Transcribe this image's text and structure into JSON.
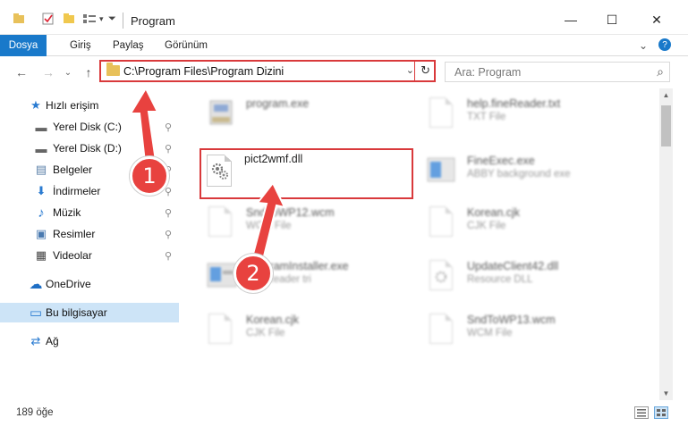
{
  "window": {
    "title": "Program",
    "minimize_glyph": "—",
    "maximize_glyph": "☐",
    "close_glyph": "✕"
  },
  "ribbon": {
    "file": "Dosya",
    "home": "Giriş",
    "share": "Paylaş",
    "view": "Görünüm",
    "expand_glyph": "⌄",
    "help_glyph": "?"
  },
  "nav": {
    "back_glyph": "←",
    "forward_glyph": "→",
    "recent_glyph": "⌄",
    "up_glyph": "↑",
    "address_path": "C:\\Program Files\\Program Dizini",
    "address_dropdown_glyph": "⌄",
    "refresh_glyph": "↻",
    "search_placeholder": "Ara: Program",
    "search_glyph": "⌕"
  },
  "sidebar": {
    "items": [
      {
        "label": "Hızlı erişim",
        "icon": "star-icon",
        "glyph": "★",
        "pinned": false
      },
      {
        "label": "Yerel Disk (C:)",
        "icon": "drive-icon",
        "glyph": "▬",
        "pinned": true
      },
      {
        "label": "Yerel Disk (D:)",
        "icon": "drive-icon",
        "glyph": "▬",
        "pinned": true
      },
      {
        "label": "Belgeler",
        "icon": "documents-icon",
        "glyph": "▤",
        "pinned": true
      },
      {
        "label": "İndirmeler",
        "icon": "download-icon",
        "glyph": "⬇",
        "pinned": true
      },
      {
        "label": "Müzik",
        "icon": "music-icon",
        "glyph": "♪",
        "pinned": true
      },
      {
        "label": "Resimler",
        "icon": "pictures-icon",
        "glyph": "▣",
        "pinned": true
      },
      {
        "label": "Videolar",
        "icon": "video-icon",
        "glyph": "▦",
        "pinned": true
      },
      {
        "label": "OneDrive",
        "icon": "cloud-icon",
        "glyph": "☁",
        "pinned": false
      },
      {
        "label": "Bu bilgisayar",
        "icon": "computer-icon",
        "glyph": "▭",
        "pinned": false
      },
      {
        "label": "Ağ",
        "icon": "network-icon",
        "glyph": "⇄",
        "pinned": false
      }
    ],
    "pin_glyph": "⚲"
  },
  "files": [
    {
      "name": "program.exe",
      "type": "",
      "blurred": true
    },
    {
      "name": "help.fineReader.txt",
      "type": "TXT File",
      "blurred": true
    },
    {
      "name": "pict2wmf.dll",
      "type": "",
      "blurred": false
    },
    {
      "name": "FineExec.exe",
      "type": "ABBY background exe",
      "blurred": true
    },
    {
      "name": "SndToWP12.wcm",
      "type": "WCM File",
      "blurred": true
    },
    {
      "name": "Korean.cjk",
      "type": "CJK File",
      "blurred": true
    },
    {
      "name": "ProgramInstaller.exe",
      "type": "FineReader tri",
      "blurred": true
    },
    {
      "name": "UpdateClient42.dll",
      "type": "Resource DLL",
      "blurred": true
    },
    {
      "name": "Korean.cjk",
      "type": "CJK File",
      "blurred": true
    },
    {
      "name": "SndToWP13.wcm",
      "type": "WCM File",
      "blurred": true
    }
  ],
  "status": {
    "item_count": "189 öğe"
  },
  "callouts": {
    "step1": "1",
    "step2": "2"
  },
  "colors": {
    "accent": "#1979ca",
    "highlight_box": "#d9393b",
    "badge": "#e8423f",
    "selected_row": "#cde4f7"
  }
}
